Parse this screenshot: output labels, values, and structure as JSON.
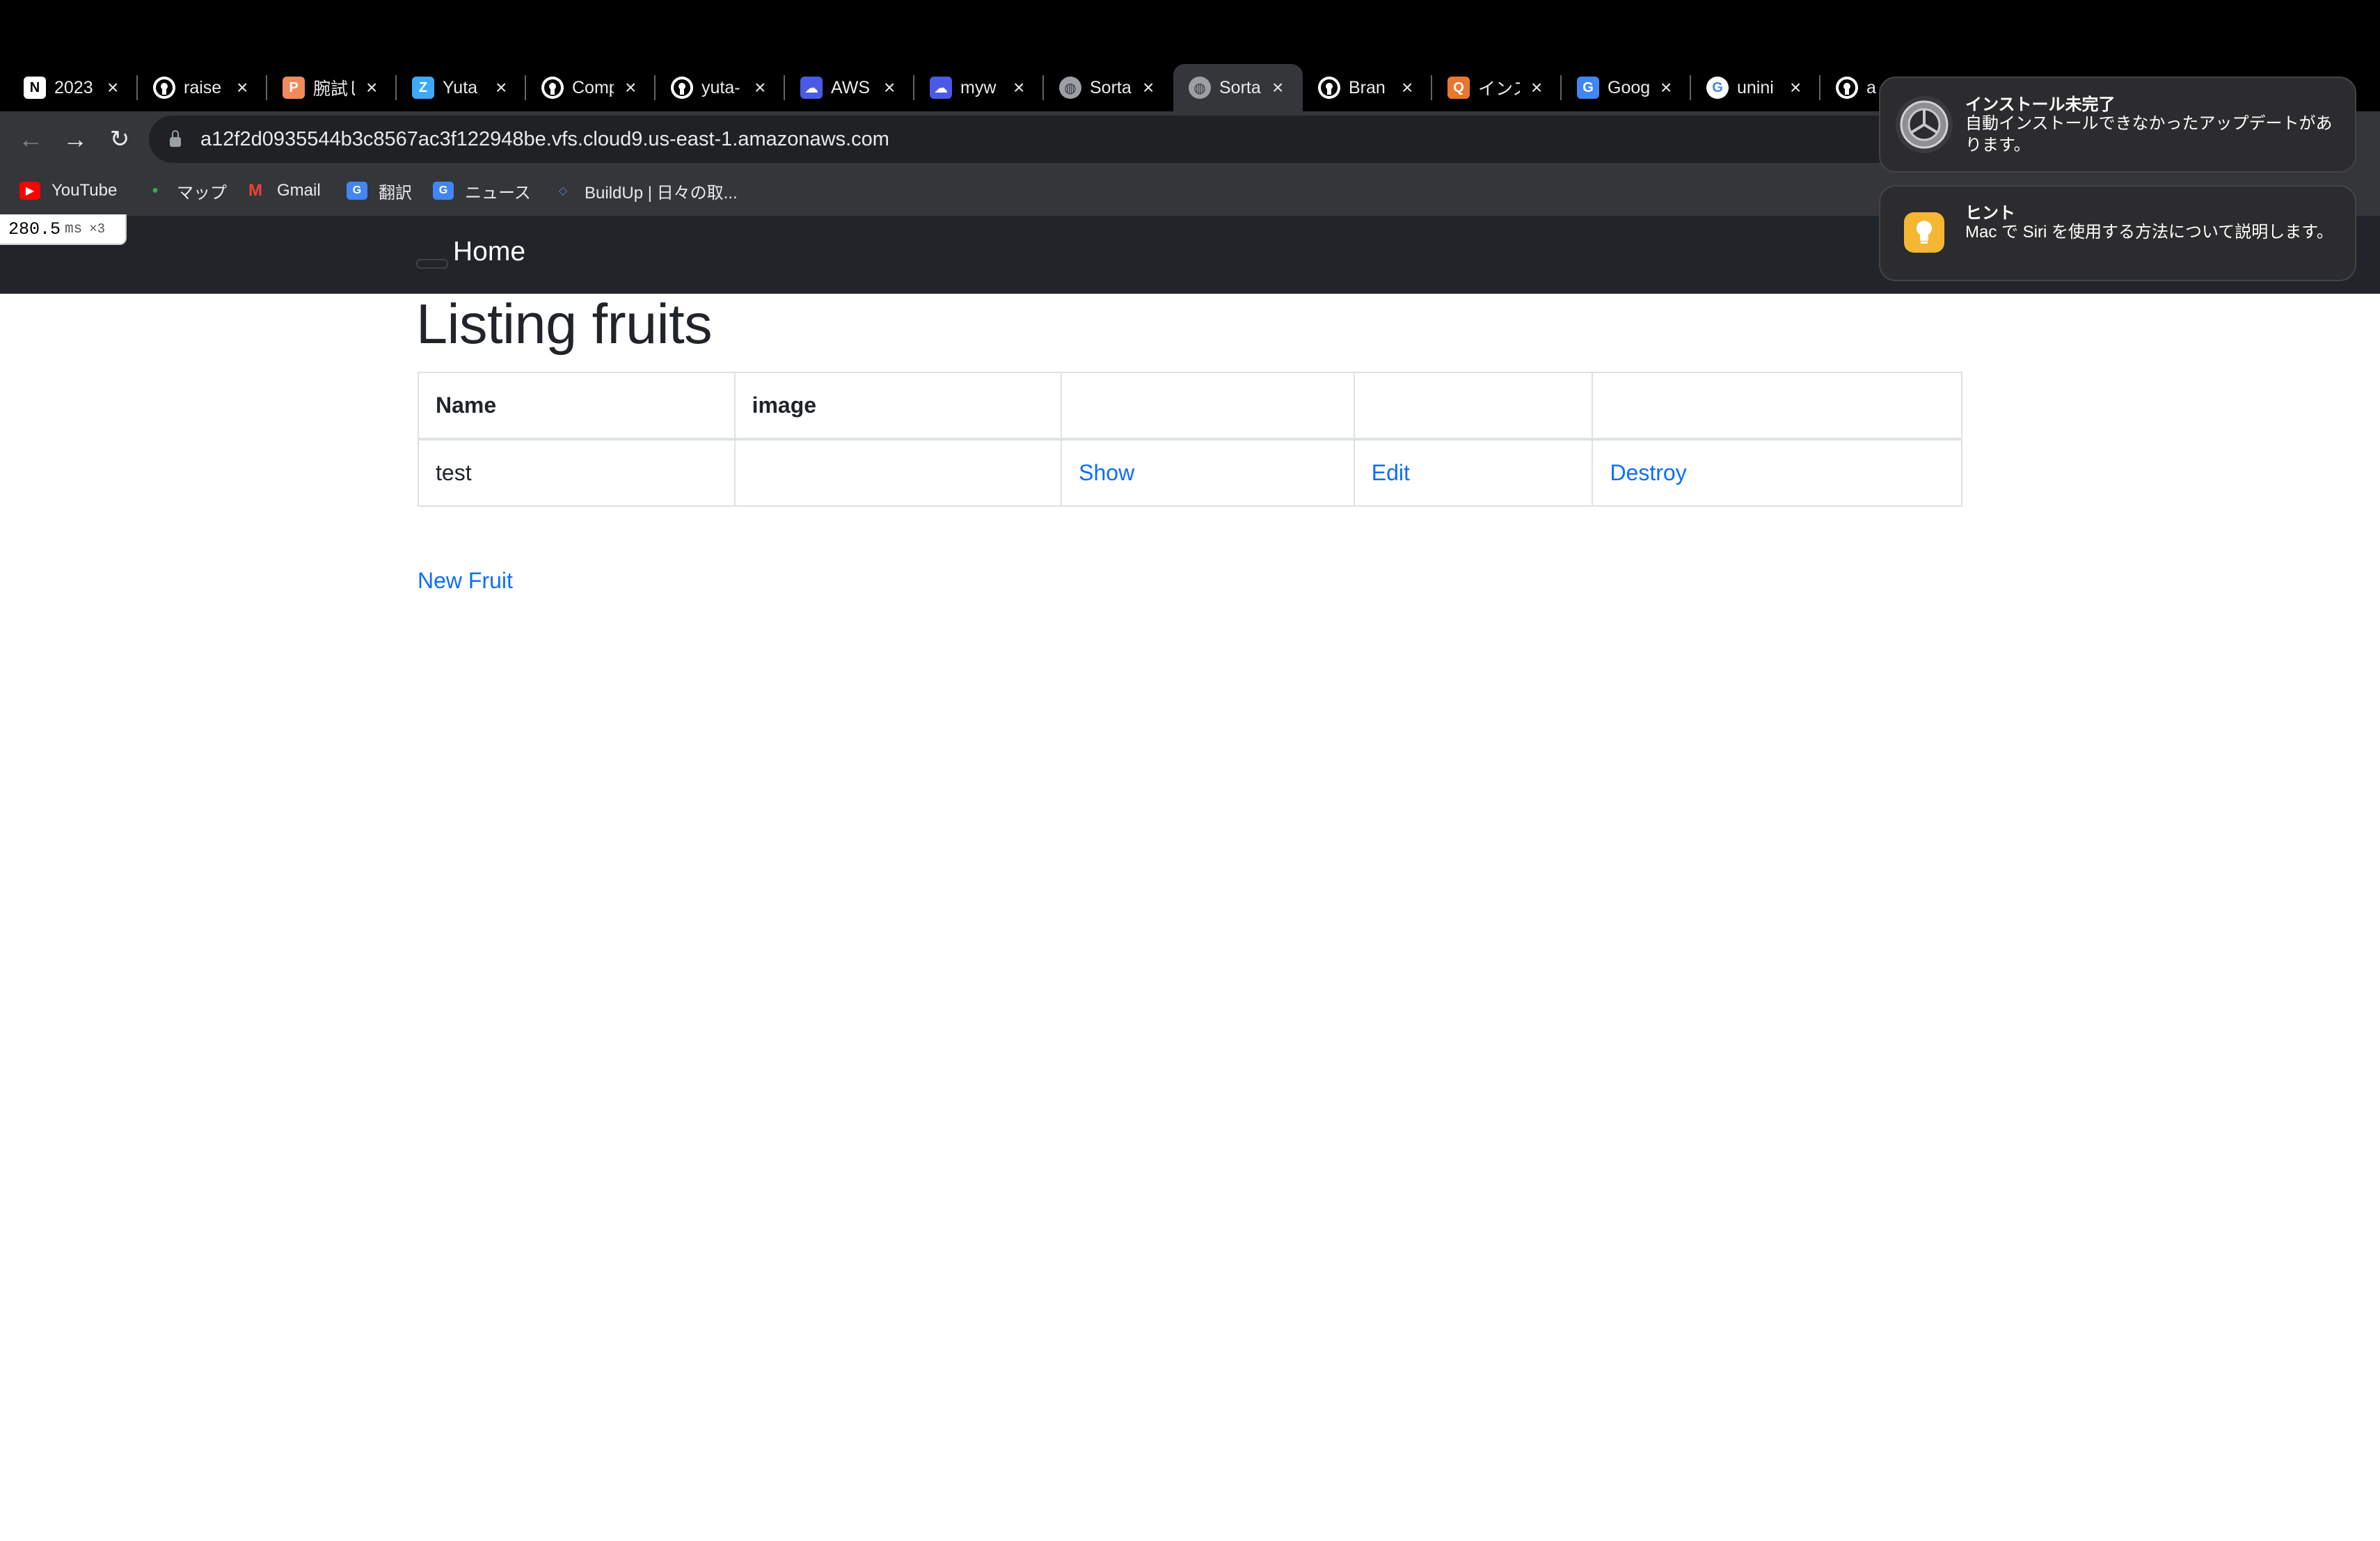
{
  "browser": {
    "tabs": [
      {
        "label": "2023",
        "favicon": "notion-icon",
        "color": "#000000"
      },
      {
        "label": "raise",
        "favicon": "github-icon",
        "color": "#000000"
      },
      {
        "label": "腕試し",
        "favicon": "paiza-icon",
        "color": "#f08a5d"
      },
      {
        "label": "Yuta",
        "favicon": "zenn-icon",
        "color": "#3ea8ff"
      },
      {
        "label": "Comp",
        "favicon": "github-icon",
        "color": "#000000"
      },
      {
        "label": "yuta-",
        "favicon": "github-icon",
        "color": "#000000"
      },
      {
        "label": "AWS",
        "favicon": "cloud9-icon",
        "color": "#4b5ae6"
      },
      {
        "label": "myw",
        "favicon": "cloud9-icon",
        "color": "#4b5ae6"
      },
      {
        "label": "Sorta",
        "favicon": "globe-icon",
        "color": "#9aa0a6"
      },
      {
        "label": "Sorta",
        "favicon": "globe-icon",
        "color": "#9aa0a6",
        "active": true
      },
      {
        "label": "Bran",
        "favicon": "github-icon",
        "color": "#000000"
      },
      {
        "label": "インス",
        "favicon": "qiita-icon",
        "color": "#e8772e"
      },
      {
        "label": "Goog",
        "favicon": "translate-icon",
        "color": "#4285f4"
      },
      {
        "label": "unini",
        "favicon": "google-icon",
        "color": "#ffffff"
      },
      {
        "label": "a",
        "favicon": "github-icon",
        "color": "#000000"
      }
    ],
    "url": "a12f2d0935544b3c8567ac3f122948be.vfs.cloud9.us-east-1.amazonaws.com",
    "bookmarks": [
      {
        "label": "YouTube",
        "icon": "youtube-icon",
        "color": "#ff0000"
      },
      {
        "label": "マップ",
        "icon": "maps-icon",
        "color": "#34a853"
      },
      {
        "label": "Gmail",
        "icon": "gmail-icon",
        "color": "#ea4335"
      },
      {
        "label": "翻訳",
        "icon": "translate-icon",
        "color": "#4285f4"
      },
      {
        "label": "ニュース",
        "icon": "news-icon",
        "color": "#4285f4"
      },
      {
        "label": "BuildUp | 日々の取...",
        "icon": "buildup-icon",
        "color": "#5b7fd6"
      }
    ]
  },
  "timing": {
    "value": "280.5",
    "unit": "ms",
    "mult": "×3"
  },
  "navbar": {
    "brand": "Home"
  },
  "page": {
    "title": "Listing fruits",
    "table": {
      "headers": [
        "Name",
        "image",
        "",
        "",
        ""
      ],
      "rows": [
        {
          "name": "test",
          "image": "",
          "show": "Show",
          "edit": "Edit",
          "destroy": "Destroy"
        }
      ]
    },
    "new_link": "New Fruit"
  },
  "notifications": [
    {
      "title": "インストール未完了",
      "body": "自動インストールできなかったアップデートがあります。",
      "icon": "system-preferences-icon"
    },
    {
      "title": "ヒント",
      "body": "Mac で Siri を使用する方法について説明します。",
      "icon": "tips-icon"
    }
  ],
  "accent_color": "#0d6efd",
  "navbar_color": "#212529"
}
